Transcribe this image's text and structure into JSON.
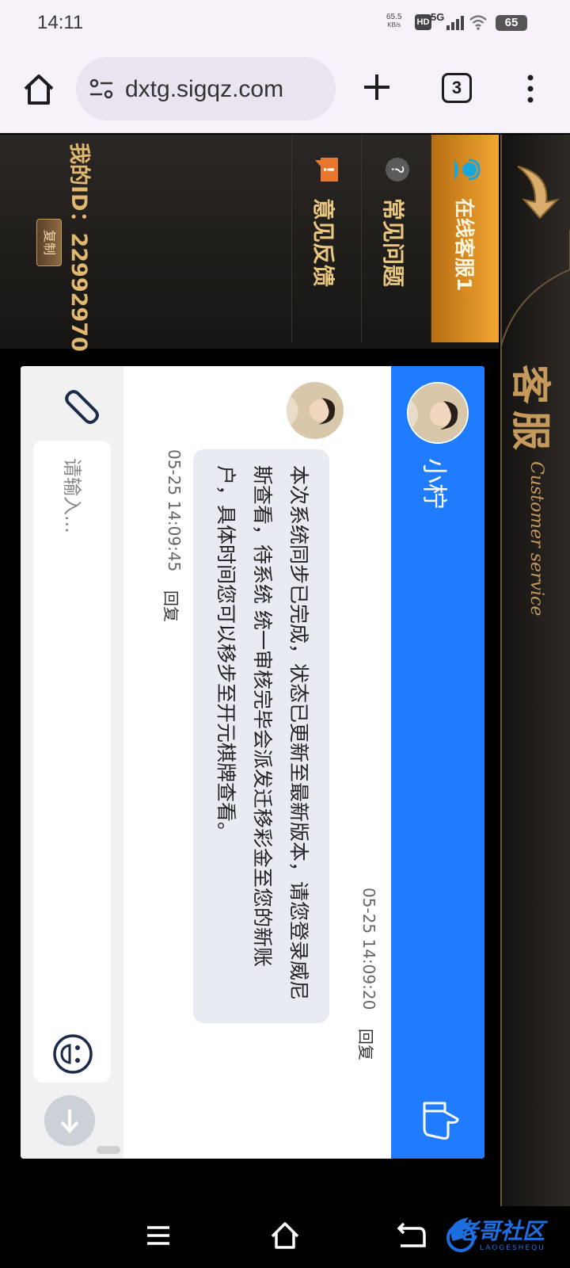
{
  "status": {
    "time": "14:11",
    "net_speed": "65.5",
    "net_unit": "KB/s",
    "hd": "HD",
    "network": "5G",
    "battery": "65"
  },
  "browser": {
    "url": "dxtg.sigqz.com",
    "tab_count": "3"
  },
  "header": {
    "title_cn": "客服",
    "title_en": "Customer service"
  },
  "sidebar": {
    "items": [
      {
        "label": "在线客服1",
        "icon": "headset-icon",
        "active": true
      },
      {
        "label": "常见问题",
        "icon": "question-icon",
        "active": false
      },
      {
        "label": "意见反馈",
        "icon": "feedback-icon",
        "active": false
      }
    ],
    "my_id_label": "我的ID：",
    "my_id_value": "22992970",
    "copy_label": "复制"
  },
  "chat": {
    "agent_name": "小柠",
    "message": {
      "text": "本次系统同步已完成，状态已更新至最新版本，请您登录威尼斯查看，待系统 统一审核完毕会派发迁移彩金至您的新账户，具体时间您可以移步至开元棋牌查看。",
      "time_1": "05-25 14:09:20",
      "reply_1": "回复",
      "time_2": "05-25 14:09:45",
      "reply_2": "回复"
    },
    "input_placeholder": "请输入...",
    "accent_color": "#1f7cff"
  },
  "watermark": {
    "text": "老哥社区",
    "subtext": "LAOGESHEQU"
  }
}
